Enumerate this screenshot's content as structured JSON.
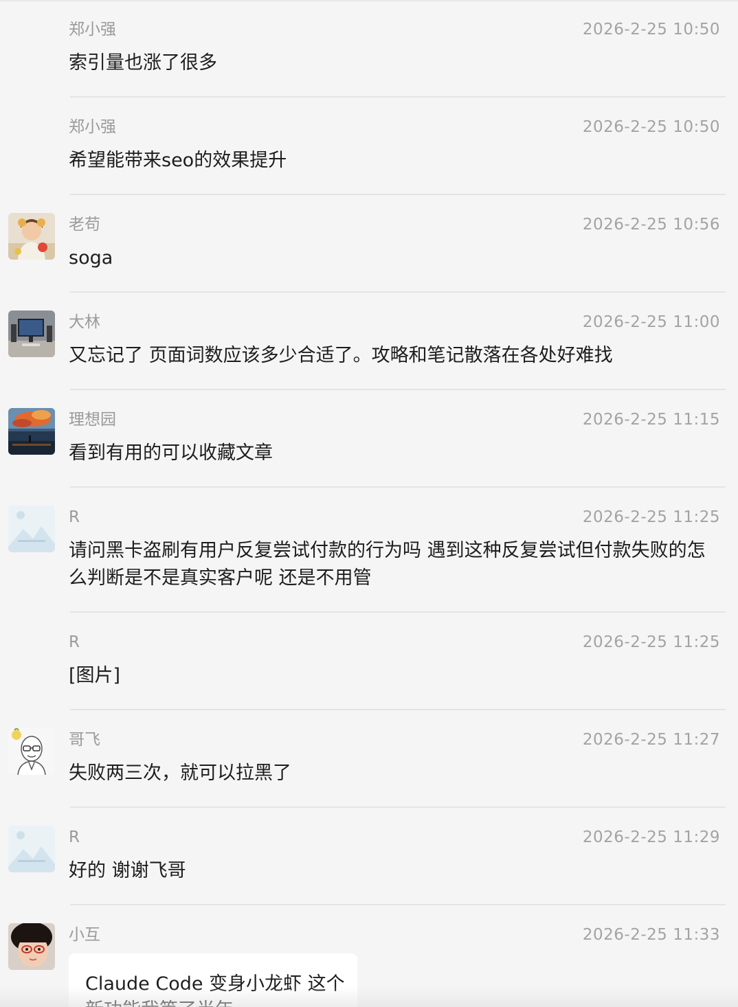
{
  "messages": [
    {
      "name": "郑小强",
      "time": "2026-2-25 10:50",
      "text": "索引量也涨了很多",
      "avatar": "none"
    },
    {
      "name": "郑小强",
      "time": "2026-2-25 10:50",
      "text": "希望能带来seo的效果提升",
      "avatar": "none"
    },
    {
      "name": "老苟",
      "time": "2026-2-25 10:56",
      "text": "soga",
      "avatar": "child-photo"
    },
    {
      "name": "大林",
      "time": "2026-2-25 11:00",
      "text": "又忘记了 页面词数应该多少合适了。攻略和笔记散落在各处好难找",
      "avatar": "desk-photo"
    },
    {
      "name": "理想园",
      "time": "2026-2-25 11:15",
      "text": "看到有用的可以收藏文章",
      "avatar": "sunset-photo"
    },
    {
      "name": "R",
      "time": "2026-2-25 11:25",
      "text": "请问黑卡盗刷有用户反复尝试付款的行为吗  遇到这种反复尝试但付款失败的怎么判断是不是真实客户呢  还是不用管",
      "avatar": "placeholder-image"
    },
    {
      "name": "R",
      "time": "2026-2-25 11:25",
      "text": "[图片]",
      "avatar": "none"
    },
    {
      "name": "哥飞",
      "time": "2026-2-25 11:27",
      "text": "失败两三次，就可以拉黑了",
      "avatar": "cartoon-face"
    },
    {
      "name": "R",
      "time": "2026-2-25 11:29",
      "text": "好的  谢谢飞哥",
      "avatar": "placeholder-image"
    },
    {
      "name": "小互",
      "time": "2026-2-25 11:33",
      "text": "",
      "avatar": "girl-photo"
    }
  ],
  "card": {
    "text": "Claude Code 变身小龙虾 这个新功能我等了半年"
  },
  "colors": {
    "background": "#f5f5f5",
    "name": "#9a9a9a",
    "time": "#a3a3a3",
    "text": "#1d1d1d",
    "separator": "#e4e4e4",
    "card": "#ffffff"
  }
}
